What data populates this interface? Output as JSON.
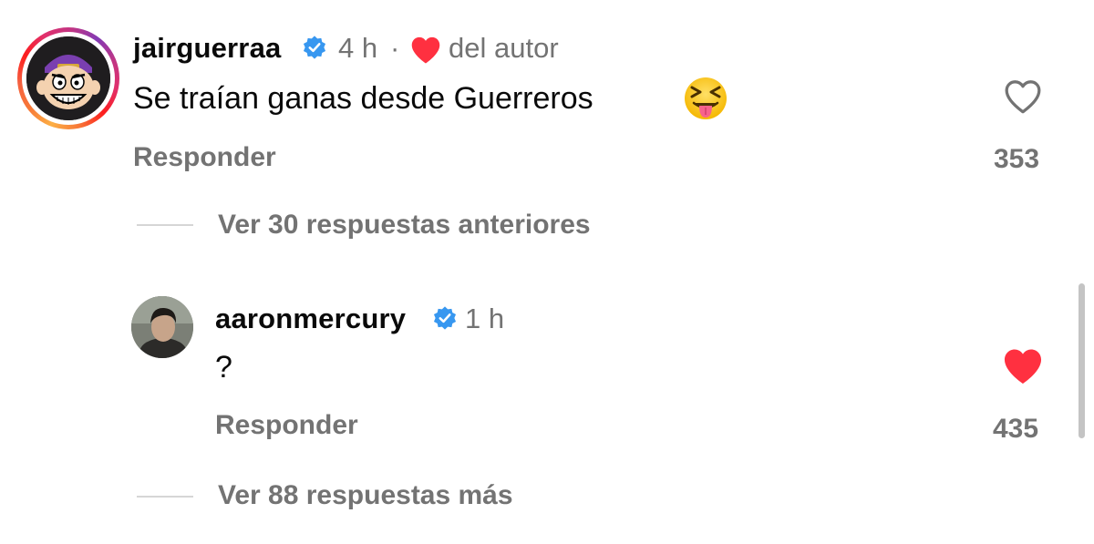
{
  "colors": {
    "text": "#0a0a0a",
    "secondary": "#737373",
    "verified": "#3797f0",
    "like_red": "#ff3040"
  },
  "comments": [
    {
      "username": "jairguerraa",
      "verified": true,
      "time": "4 h",
      "separator": "·",
      "author_like_label": "del autor",
      "text": "Se traían ganas desde Guerreros",
      "emoji": "😝",
      "emoji_icon": "squinting-face-with-tongue",
      "reply_label": "Responder",
      "like_count": "353",
      "liked": false,
      "view_replies": "Ver 30 respuestas anteriores"
    },
    {
      "username": "aaronmercury",
      "verified": true,
      "time": "1 h",
      "text": "?",
      "reply_label": "Responder",
      "like_count": "435",
      "liked": true,
      "view_replies": "Ver 88 respuestas más"
    }
  ]
}
